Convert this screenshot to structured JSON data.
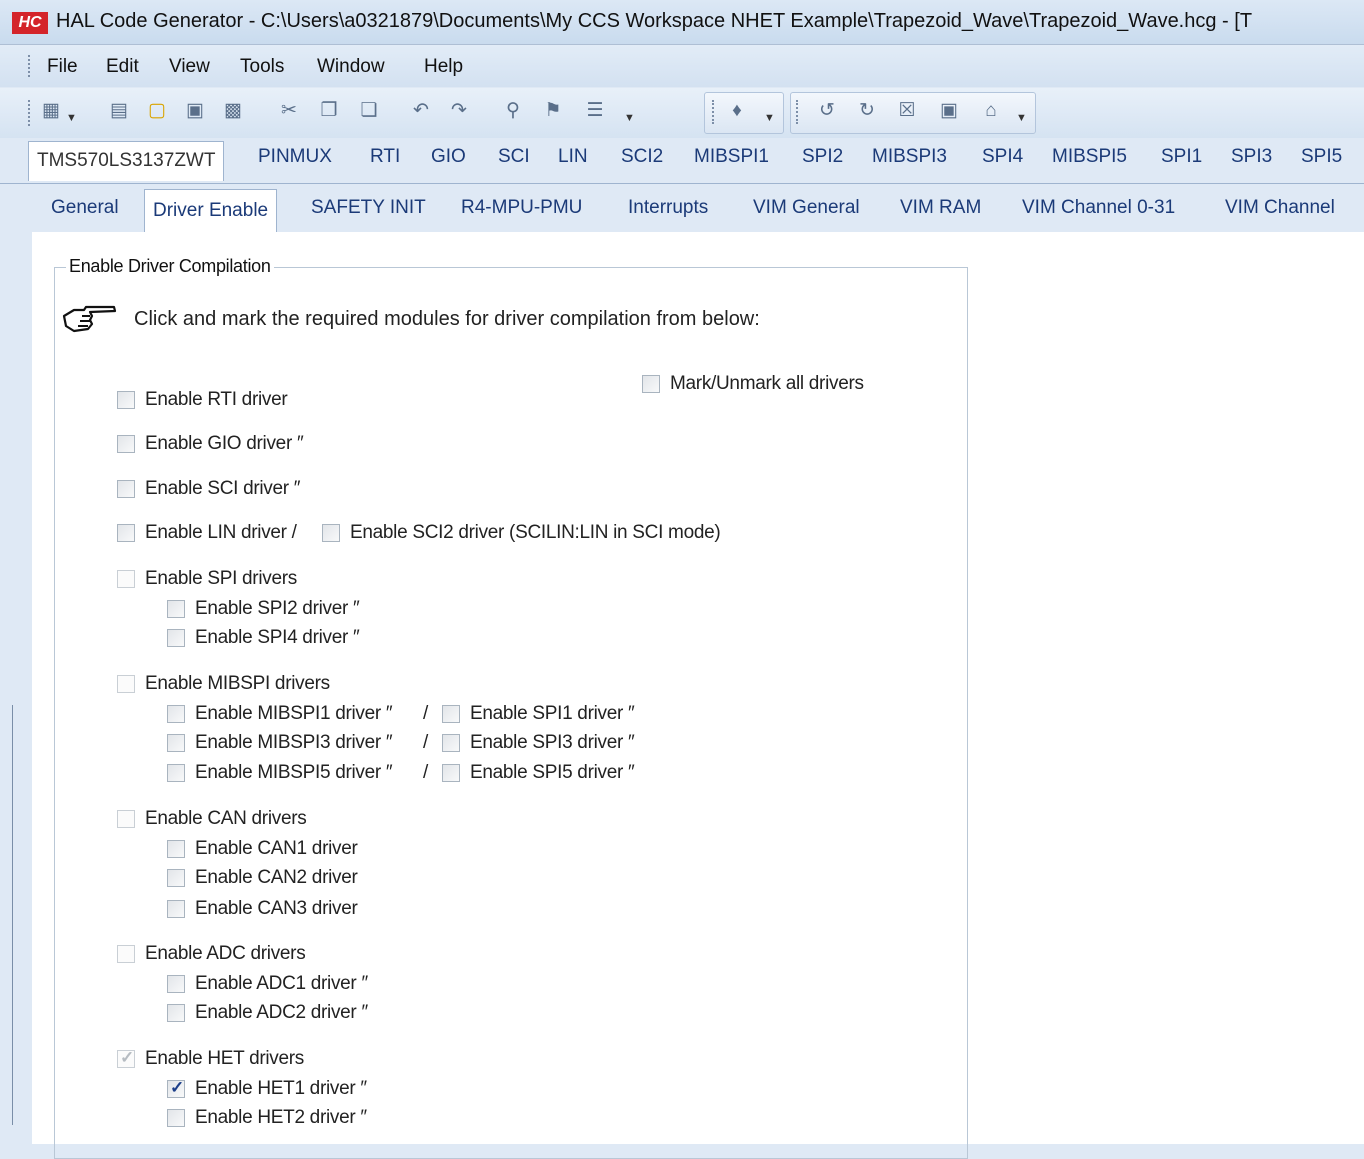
{
  "window": {
    "title": "HAL Code Generator - C:\\Users\\a0321879\\Documents\\My CCS Workspace NHET Example\\Trapezoid_Wave\\Trapezoid_Wave.hcg - [T",
    "app_icon": "HC"
  },
  "menu": [
    "File",
    "Edit",
    "View",
    "Tools",
    "Window",
    "Help"
  ],
  "device_tabs": [
    "TMS570LS3137ZWT",
    "PINMUX",
    "RTI",
    "GIO",
    "SCI",
    "LIN",
    "SCI2",
    "MIBSPI1",
    "SPI2",
    "MIBSPI3",
    "SPI4",
    "MIBSPI5",
    "SPI1",
    "SPI3",
    "SPI5"
  ],
  "sub_tabs": [
    "General",
    "Driver Enable",
    "SAFETY INIT",
    "R4-MPU-PMU",
    "Interrupts",
    "VIM General",
    "VIM RAM",
    "VIM Channel 0-31",
    "VIM Channel"
  ],
  "panel": {
    "legend": "Enable Driver Compilation",
    "instruction": "Click and mark the required modules for driver compilation from below:",
    "mark_all": "Mark/Unmark all drivers"
  },
  "drivers": {
    "rti": "Enable RTI driver",
    "gio": "Enable GIO driver ″",
    "sci": "Enable SCI driver ″",
    "lin": "Enable LIN driver /",
    "sci2": "Enable SCI2 driver (SCILIN:LIN in SCI mode)",
    "spi": "Enable SPI drivers",
    "spi2": "Enable SPI2 driver ″",
    "spi4": "Enable SPI4 driver ″",
    "mibspi": "Enable MIBSPI drivers",
    "mibspi1": "Enable MIBSPI1 driver ″",
    "spi1": "Enable SPI1 driver ″",
    "mibspi3": "Enable MIBSPI3 driver ″",
    "spi3": "Enable SPI3 driver ″",
    "mibspi5": "Enable MIBSPI5 driver ″",
    "spi5": "Enable SPI5 driver ″",
    "can": "Enable CAN drivers",
    "can1": "Enable CAN1 driver",
    "can2": "Enable CAN2 driver",
    "can3": "Enable CAN3 driver",
    "adc": "Enable ADC drivers",
    "adc1": "Enable ADC1 driver ″",
    "adc2": "Enable ADC2 driver ″",
    "het": "Enable HET drivers",
    "het1": "Enable HET1 driver ″",
    "het2": "Enable HET2 driver ″"
  },
  "separator": "/",
  "checked": {
    "het": true,
    "het1": true
  },
  "colors": {
    "app_icon": "#d4242a",
    "tab_text": "#1b3a78",
    "chrome": "#dfe9f5"
  }
}
